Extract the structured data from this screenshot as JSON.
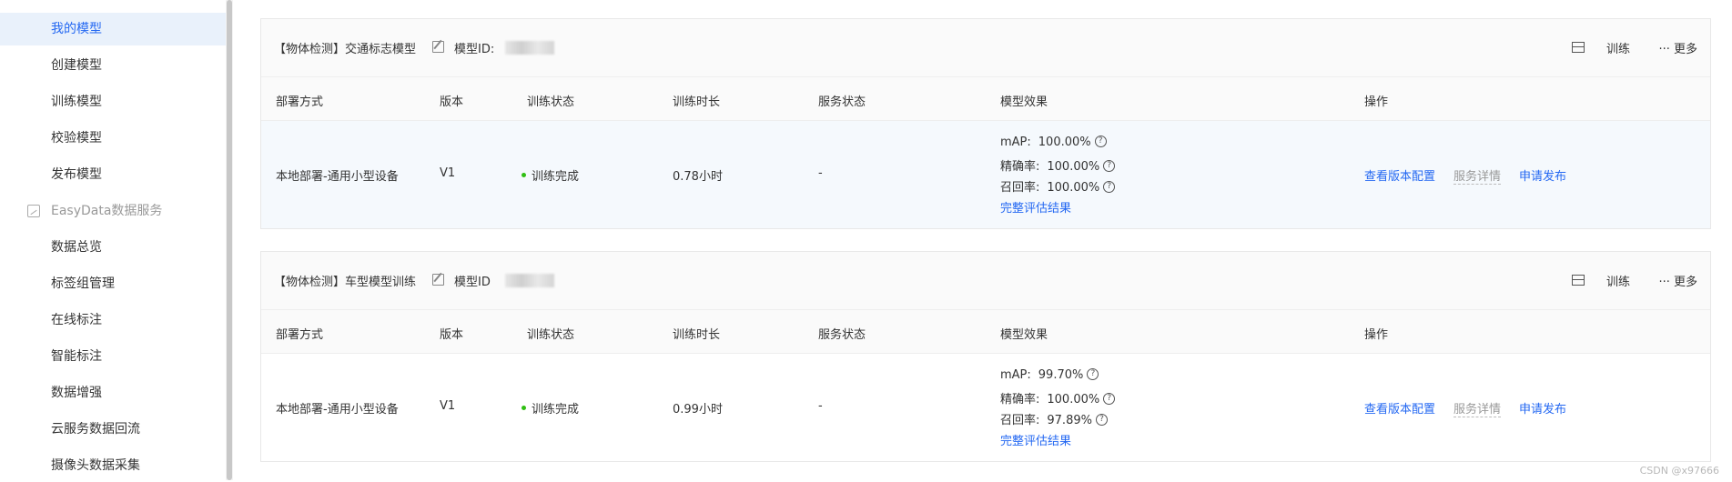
{
  "sidebar": {
    "items": [
      {
        "label": "我的模型",
        "active": true
      },
      {
        "label": "创建模型"
      },
      {
        "label": "训练模型"
      },
      {
        "label": "校验模型"
      },
      {
        "label": "发布模型"
      },
      {
        "label": "EasyData数据服务",
        "section": true,
        "icon": "chart-icon"
      },
      {
        "label": "数据总览"
      },
      {
        "label": "标签组管理"
      },
      {
        "label": "在线标注"
      },
      {
        "label": "智能标注"
      },
      {
        "label": "数据增强"
      },
      {
        "label": "云服务数据回流"
      },
      {
        "label": "摄像头数据采集"
      }
    ]
  },
  "table_headers": {
    "deploy": "部署方式",
    "version": "版本",
    "train_status": "训练状态",
    "train_time": "训练时长",
    "service_status": "服务状态",
    "effect": "模型效果",
    "action": "操作"
  },
  "card_actions": {
    "train": "训练",
    "more": "··· 更多",
    "model_id_label_1": "模型ID:",
    "model_id_label_2": "模型ID"
  },
  "models": [
    {
      "title": "【物体检测】交通标志模型",
      "deploy": "本地部署-通用小型设备",
      "version": "V1",
      "train_status": "训练完成",
      "train_time": "0.78小时",
      "service_status": "-",
      "map_label": "mAP:",
      "map": "100.00%",
      "precision_label": "精确率:",
      "precision": "100.00%",
      "recall_label": "召回率:",
      "recall": "100.00%",
      "eval_link": "完整评估结果",
      "action_config": "查看版本配置",
      "action_detail": "服务详情",
      "action_publish": "申请发布"
    },
    {
      "title": "【物体检测】车型模型训练",
      "deploy": "本地部署-通用小型设备",
      "version": "V1",
      "train_status": "训练完成",
      "train_time": "0.99小时",
      "service_status": "-",
      "map_label": "mAP:",
      "map": "99.70%",
      "precision_label": "精确率:",
      "precision": "100.00%",
      "recall_label": "召回率:",
      "recall": "97.89%",
      "eval_link": "完整评估结果",
      "action_config": "查看版本配置",
      "action_detail": "服务详情",
      "action_publish": "申请发布"
    }
  ],
  "watermark": "CSDN @x97666",
  "colors": {
    "accent": "#2468f2",
    "success": "#30bf13",
    "active_bg": "#e9f1fb"
  }
}
